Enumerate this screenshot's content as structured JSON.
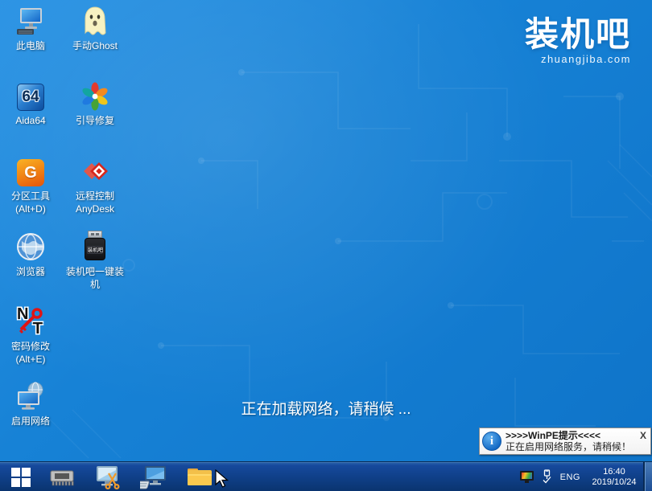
{
  "desktop": {
    "logo": {
      "title": "装机吧",
      "subtitle": "zhuangjiba.com"
    },
    "loading_message": "正在加载网络，请稍候 ...",
    "icons": [
      {
        "label": "此电脑"
      },
      {
        "label": "手动Ghost"
      },
      {
        "label": "Aida64",
        "icon_text": "64"
      },
      {
        "label": "引导修复"
      },
      {
        "label": "分区工具",
        "label2": "(Alt+D)",
        "icon_text": "G"
      },
      {
        "label": "远程控制",
        "label2": "AnyDesk"
      },
      {
        "label": "浏览器"
      },
      {
        "label": "装机吧一键装机",
        "icon_text": "装机吧"
      },
      {
        "label": "密码修改",
        "label2": "(Alt+E)",
        "icon_text_n": "N",
        "icon_text_t": "T"
      },
      {
        "label": "启用网络"
      }
    ]
  },
  "notification": {
    "title": ">>>>WinPE提示<<<<",
    "close_label": "X",
    "message": "正在启用网络服务，请稍候！"
  },
  "taskbar": {
    "tray": {
      "language": "ENG",
      "time": "16:40",
      "date": "2019/10/24"
    }
  },
  "colors": {
    "desktop_blue": "#1782d6",
    "taskbar_blue": "#0f3f87",
    "info_icon_blue": "#1268c4"
  }
}
